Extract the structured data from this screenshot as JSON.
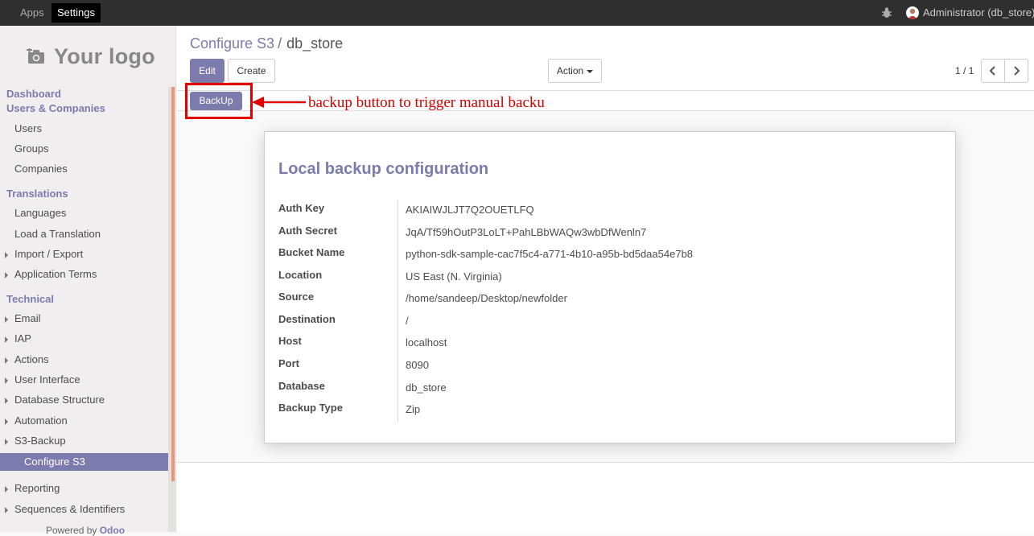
{
  "topbar": {
    "apps": "Apps",
    "settings": "Settings",
    "user": "Administrator (db_store)"
  },
  "sidebar": {
    "logo_text": "Your logo",
    "items": [
      {
        "label": "Dashboard",
        "kind": "category"
      },
      {
        "label": "Users & Companies",
        "kind": "category"
      },
      {
        "label": "Users",
        "kind": "sub"
      },
      {
        "label": "Groups",
        "kind": "sub"
      },
      {
        "label": "Companies",
        "kind": "sub"
      },
      {
        "label": "Translations",
        "kind": "category"
      },
      {
        "label": "Languages",
        "kind": "sub"
      },
      {
        "label": "Load a Translation",
        "kind": "sub"
      },
      {
        "label": "Import / Export",
        "kind": "sub-expandable"
      },
      {
        "label": "Application Terms",
        "kind": "sub-expandable"
      },
      {
        "label": "Technical",
        "kind": "category"
      },
      {
        "label": "Email",
        "kind": "sub-expandable"
      },
      {
        "label": "IAP",
        "kind": "sub-expandable"
      },
      {
        "label": "Actions",
        "kind": "sub-expandable"
      },
      {
        "label": "User Interface",
        "kind": "sub-expandable"
      },
      {
        "label": "Database Structure",
        "kind": "sub-expandable"
      },
      {
        "label": "Automation",
        "kind": "sub-expandable"
      },
      {
        "label": "S3-Backup",
        "kind": "sub-expandable"
      },
      {
        "label": "Configure S3",
        "kind": "active"
      },
      {
        "label": "Reporting",
        "kind": "sub-expandable"
      },
      {
        "label": "Sequences & Identifiers",
        "kind": "sub-expandable"
      }
    ],
    "powered_by": "Powered by",
    "powered_brand": "Odoo"
  },
  "breadcrumb": {
    "parent": "Configure S3",
    "separator": "/",
    "current": "db_store"
  },
  "buttons": {
    "edit": "Edit",
    "create": "Create",
    "action": "Action",
    "backup": "BackUp"
  },
  "pager": {
    "value": "1 / 1"
  },
  "annotation": {
    "text": "backup button to trigger manual backu"
  },
  "form": {
    "title": "Local backup configuration",
    "fields": [
      {
        "label": "Auth Key",
        "value": "AKIAIWJLJT7Q2OUETLFQ"
      },
      {
        "label": "Auth Secret",
        "value": "JqA/Tf59hOutP3LoLT+PahLBbWAQw3wbDfWenln7"
      },
      {
        "label": "Bucket Name",
        "value": "python-sdk-sample-cac7f5c4-a771-4b10-a95b-bd5daa54e7b8"
      },
      {
        "label": "Location",
        "value": "US East (N. Virginia)"
      },
      {
        "label": "Source",
        "value": "/home/sandeep/Desktop/newfolder"
      },
      {
        "label": "Destination",
        "value": "/"
      },
      {
        "label": "Host",
        "value": "localhost"
      },
      {
        "label": "Port",
        "value": "8090"
      },
      {
        "label": "Database",
        "value": "db_store"
      },
      {
        "label": "Backup Type",
        "value": "Zip"
      }
    ]
  },
  "colors": {
    "brand": "#7c7bad",
    "annotation": "#d40000"
  }
}
